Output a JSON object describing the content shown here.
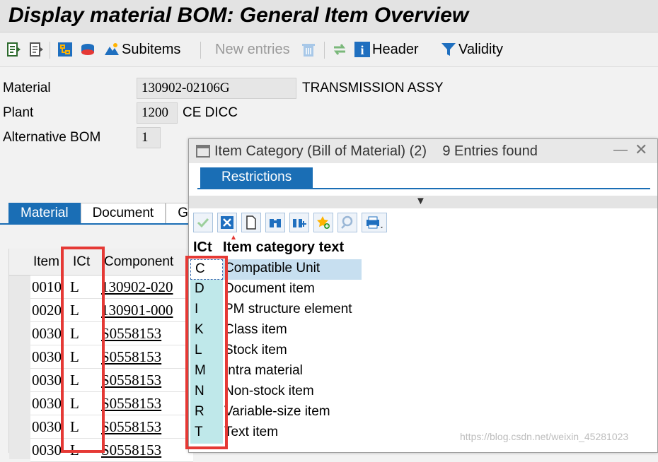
{
  "window": {
    "title": "Display material BOM: General Item Overview"
  },
  "toolbar": {
    "subitems_label": "Subitems",
    "new_entries_label": "New entries",
    "header_label": "Header",
    "validity_label": "Validity"
  },
  "header": {
    "material_label": "Material",
    "material_value": "130902-02106G",
    "material_desc": "TRANSMISSION ASSY",
    "plant_label": "Plant",
    "plant_value": "1200",
    "plant_desc": "CE DICC",
    "altbom_label": "Alternative BOM",
    "altbom_value": "1"
  },
  "tabs": [
    {
      "label": "Material"
    },
    {
      "label": "Document"
    },
    {
      "label": "G"
    }
  ],
  "items_table": {
    "columns": [
      "Item",
      "ICt",
      "Component"
    ],
    "rows": [
      {
        "item": "0010",
        "ict": "L",
        "component": "130902-020"
      },
      {
        "item": "0020",
        "ict": "L",
        "component": "130901-000"
      },
      {
        "item": "0030",
        "ict": "L",
        "component": "S0558153"
      },
      {
        "item": "0030",
        "ict": "L",
        "component": "S0558153"
      },
      {
        "item": "0030",
        "ict": "L",
        "component": "S0558153"
      },
      {
        "item": "0030",
        "ict": "L",
        "component": "S0558153"
      },
      {
        "item": "0030",
        "ict": "L",
        "component": "S0558153"
      },
      {
        "item": "0030",
        "ict": "L",
        "component": "S0558153"
      }
    ]
  },
  "dialog": {
    "title": "Item Category (Bill of Material) (2)",
    "entries_found": "9 Entries found",
    "tab_label": "Restrictions",
    "columns": [
      "ICt",
      "Item category text"
    ],
    "rows": [
      {
        "code": "C",
        "text": "Compatible Unit"
      },
      {
        "code": "D",
        "text": "Document item"
      },
      {
        "code": "I",
        "text": "PM structure element"
      },
      {
        "code": "K",
        "text": "Class item"
      },
      {
        "code": "L",
        "text": "Stock item"
      },
      {
        "code": "M",
        "text": "Intra material"
      },
      {
        "code": "N",
        "text": "Non-stock item"
      },
      {
        "code": "R",
        "text": "Variable-size item"
      },
      {
        "code": "T",
        "text": "Text item"
      }
    ]
  },
  "watermark": "https://blog.csdn.net/weixin_45281023",
  "colors": {
    "accent": "#1a6eb5",
    "highlight": "#e53935",
    "code_bg": "#bfe8ea"
  }
}
